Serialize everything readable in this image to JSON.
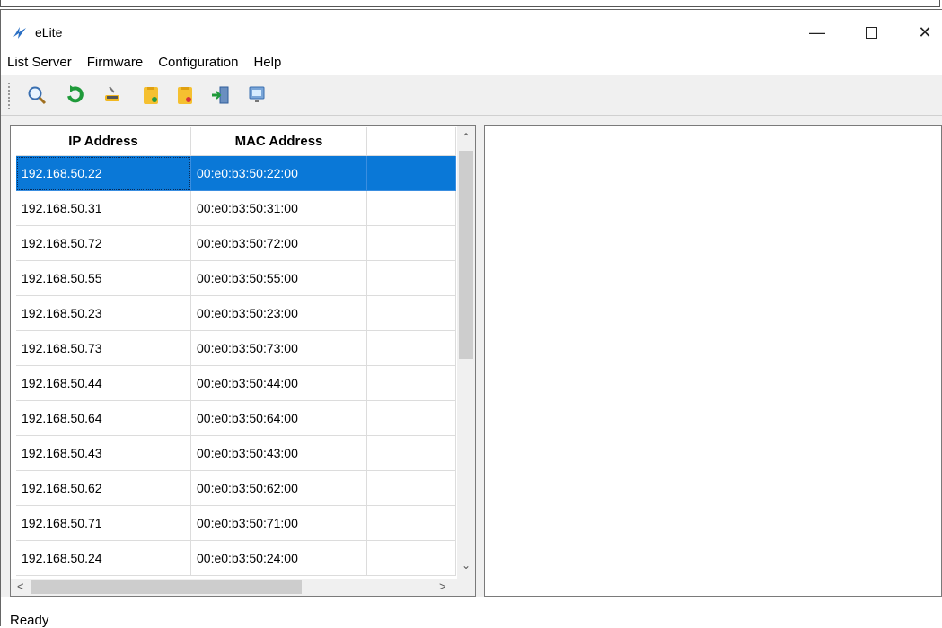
{
  "window": {
    "title": "eLite"
  },
  "menu": [
    "List Server",
    "Firmware",
    "Configuration",
    "Help"
  ],
  "toolbar": {
    "icons": [
      "search-icon",
      "refresh-icon",
      "flash-icon",
      "folder-upload-icon",
      "folder-download-icon",
      "exit-icon",
      "monitor-icon"
    ]
  },
  "table": {
    "columns": [
      "IP Address",
      "MAC Address",
      ""
    ],
    "selected_index": 0,
    "rows": [
      {
        "ip": "192.168.50.22",
        "mac": "00:e0:b3:50:22:00"
      },
      {
        "ip": "192.168.50.31",
        "mac": "00:e0:b3:50:31:00"
      },
      {
        "ip": "192.168.50.72",
        "mac": "00:e0:b3:50:72:00"
      },
      {
        "ip": "192.168.50.55",
        "mac": "00:e0:b3:50:55:00"
      },
      {
        "ip": "192.168.50.23",
        "mac": "00:e0:b3:50:23:00"
      },
      {
        "ip": "192.168.50.73",
        "mac": "00:e0:b3:50:73:00"
      },
      {
        "ip": "192.168.50.44",
        "mac": "00:e0:b3:50:44:00"
      },
      {
        "ip": "192.168.50.64",
        "mac": "00:e0:b3:50:64:00"
      },
      {
        "ip": "192.168.50.43",
        "mac": "00:e0:b3:50:43:00"
      },
      {
        "ip": "192.168.50.62",
        "mac": "00:e0:b3:50:62:00"
      },
      {
        "ip": "192.168.50.71",
        "mac": "00:e0:b3:50:71:00"
      },
      {
        "ip": "192.168.50.24",
        "mac": "00:e0:b3:50:24:00"
      }
    ]
  },
  "status": {
    "text": "Ready"
  },
  "colors": {
    "selection": "#0a78d7",
    "toolbar_bg": "#f0f0f0"
  }
}
